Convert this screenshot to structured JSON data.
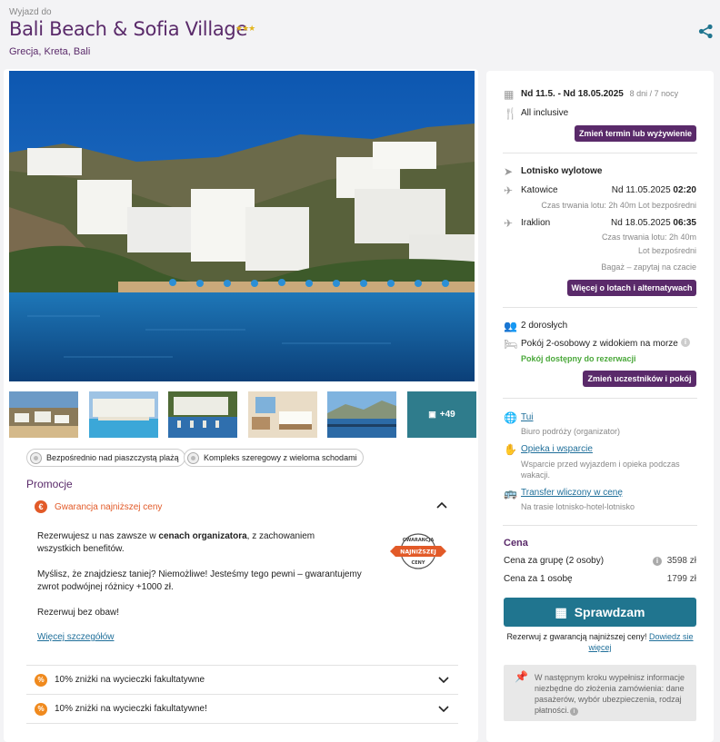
{
  "header": {
    "eyebrow": "Wyjazd do",
    "title": "Bali Beach & Sofia Village",
    "stars": "★★★",
    "location": "Grecja, Kreta, Bali"
  },
  "gallery": {
    "more_label": "+49"
  },
  "features": [
    "Bezpośrednio nad piaszczystą plażą",
    "Kompleks szeregowy z wieloma schodami"
  ],
  "promotions": {
    "heading": "Promocje",
    "guarantee": {
      "title": "Gwarancja najniższej ceny",
      "p1_a": "Rezerwujesz u nas zawsze w ",
      "p1_b": "cenach organizatora",
      "p1_c": ", z zachowaniem wszystkich benefitów.",
      "p2": "Myślisz, że znajdziesz taniej? Niemożliwe! Jesteśmy tego pewni – gwarantujemy zwrot podwójnej różnicy +1000 zł.",
      "p3": "Rezerwuj bez obaw!",
      "link": "Więcej szczegółów",
      "badge_top": "GWARANCJA",
      "badge_mid": "NAJNIŻSZEJ",
      "badge_bot": "CENY"
    },
    "discounts": [
      "10% zniżki na wycieczki fakultatywne",
      "10% zniżki na wycieczki fakultatywne!"
    ]
  },
  "booking": {
    "dates": "Nd 11.5. - Nd 18.05.2025",
    "nights": "8 dni / 7 nocy",
    "board": "All inclusive",
    "change_term_btn": "Zmień termin lub wyżywienie",
    "airport_label": "Lotnisko wylotowe",
    "outbound": {
      "from": "Katowice",
      "datetime_prefix": "Nd 11.05.2025 ",
      "time": "02:20",
      "info": "Czas trwania lotu: 2h 40m Lot bezpośredni"
    },
    "inbound": {
      "from": "Iraklion",
      "datetime_prefix": "Nd 18.05.2025 ",
      "time": "06:35",
      "info1": "Czas trwania lotu: 2h 40m",
      "info2": "Lot bezpośredni"
    },
    "baggage": "Bagaż – zapytaj na czacie",
    "flights_btn": "Więcej o lotach i alternatywach",
    "travelers": "2 dorosłych",
    "room": "Pokój 2-osobowy z widokiem na morze",
    "room_status": "Pokój dostępny do rezerwacji",
    "change_people_btn": "Zmień uczestników i pokój",
    "operator_name": "Tui",
    "operator_desc": "Biuro podróży (organizator)",
    "care_title": "Opieka i wsparcie",
    "care_desc": "Wsparcie przed wyjazdem i opieka podczas wakacji.",
    "transfer_title": "Transfer wliczony w cenę",
    "transfer_desc": "Na trasie lotnisko-hotel-lotnisko",
    "price_heading": "Cena",
    "price_group_label": "Cena za grupę (2 osoby)",
    "price_group": "3598 zł",
    "price_person_label": "Cena za 1 osobę",
    "price_person": "1799 zł",
    "check_btn": "Sprawdzam",
    "guarantee_note": "Rezerwuj z gwarancją najniższej ceny!",
    "guarantee_link_1": "Dowiedz sie",
    "guarantee_link_2": "więcej",
    "next_step_1": "W następnym kroku wypełnisz informacje",
    "next_step_2": "niezbędne do złożenia zamówienia: dane",
    "next_step_3": "pasażerów, wybór ubezpieczenia, rodzaj",
    "next_step_4": "płatności."
  },
  "colors": {
    "brand_purple": "#5a2a6a",
    "accent_teal": "#20758f",
    "guarantee_orange": "#e25a28",
    "available_green": "#4aa83a"
  }
}
